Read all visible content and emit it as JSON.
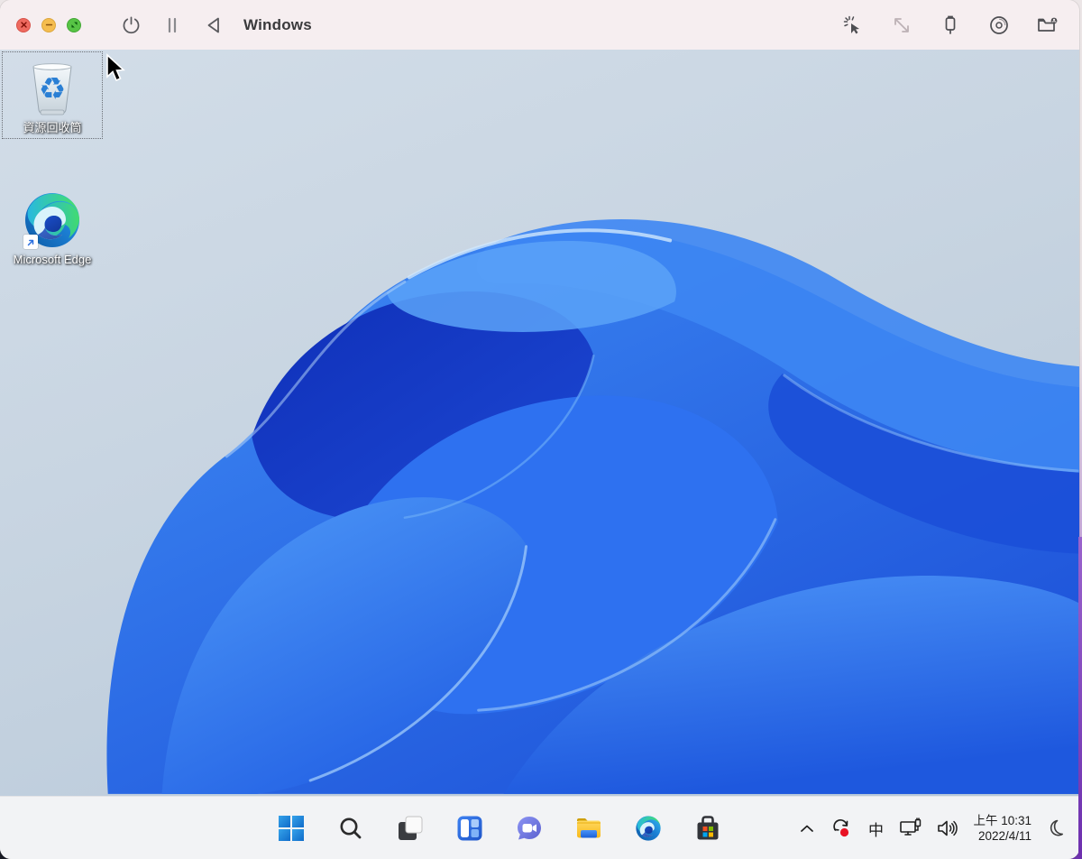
{
  "window": {
    "title": "Windows"
  },
  "toolbar": {
    "title": "Windows",
    "traffic_lights": [
      {
        "name": "close",
        "color": "#ee6a5f"
      },
      {
        "name": "minimize",
        "color": "#f5bd4f"
      },
      {
        "name": "zoom",
        "color": "#57c445"
      }
    ],
    "left_controls": [
      "power-icon",
      "pause-icon",
      "back-icon"
    ],
    "right_controls": [
      "cursor-capture-icon",
      "resize-icon",
      "usb-icon",
      "disc-drive-icon",
      "shared-folder-icon"
    ]
  },
  "desktop": {
    "icons": [
      {
        "name": "recycle-bin",
        "label": "資源回收筒",
        "selected": true
      },
      {
        "name": "microsoft-edge-shortcut",
        "label": "Microsoft Edge",
        "selected": false
      }
    ]
  },
  "taskbar": {
    "buttons": [
      {
        "name": "start",
        "label": "Start"
      },
      {
        "name": "search",
        "label": "Search"
      },
      {
        "name": "task-view",
        "label": "Task View"
      },
      {
        "name": "widgets",
        "label": "Widgets"
      },
      {
        "name": "chat",
        "label": "Chat"
      },
      {
        "name": "file-explorer",
        "label": "File Explorer"
      },
      {
        "name": "edge",
        "label": "Microsoft Edge"
      },
      {
        "name": "store",
        "label": "Microsoft Store"
      }
    ],
    "tray": {
      "icons": [
        "chevron-up-icon",
        "windows-update-icon",
        "ime-indicator",
        "network-icon",
        "volume-icon"
      ],
      "ime_label": "中",
      "clock": {
        "time": "上午 10:31",
        "date": "2022/4/11"
      },
      "focus_assist_icon": "moon-icon"
    }
  },
  "colors": {
    "titlebar_bg": "#f6eef0",
    "taskbar_bg": "#f2f3f5",
    "desktop_bg_top": "#d2dde8",
    "desktop_bg_bottom": "#b6c7d8",
    "bloom_bright": "#3f8cf5",
    "bloom_dark": "#0f2fb8",
    "update_badge_red": "#e81224",
    "mac_edge_purple": "#6d2fae"
  }
}
